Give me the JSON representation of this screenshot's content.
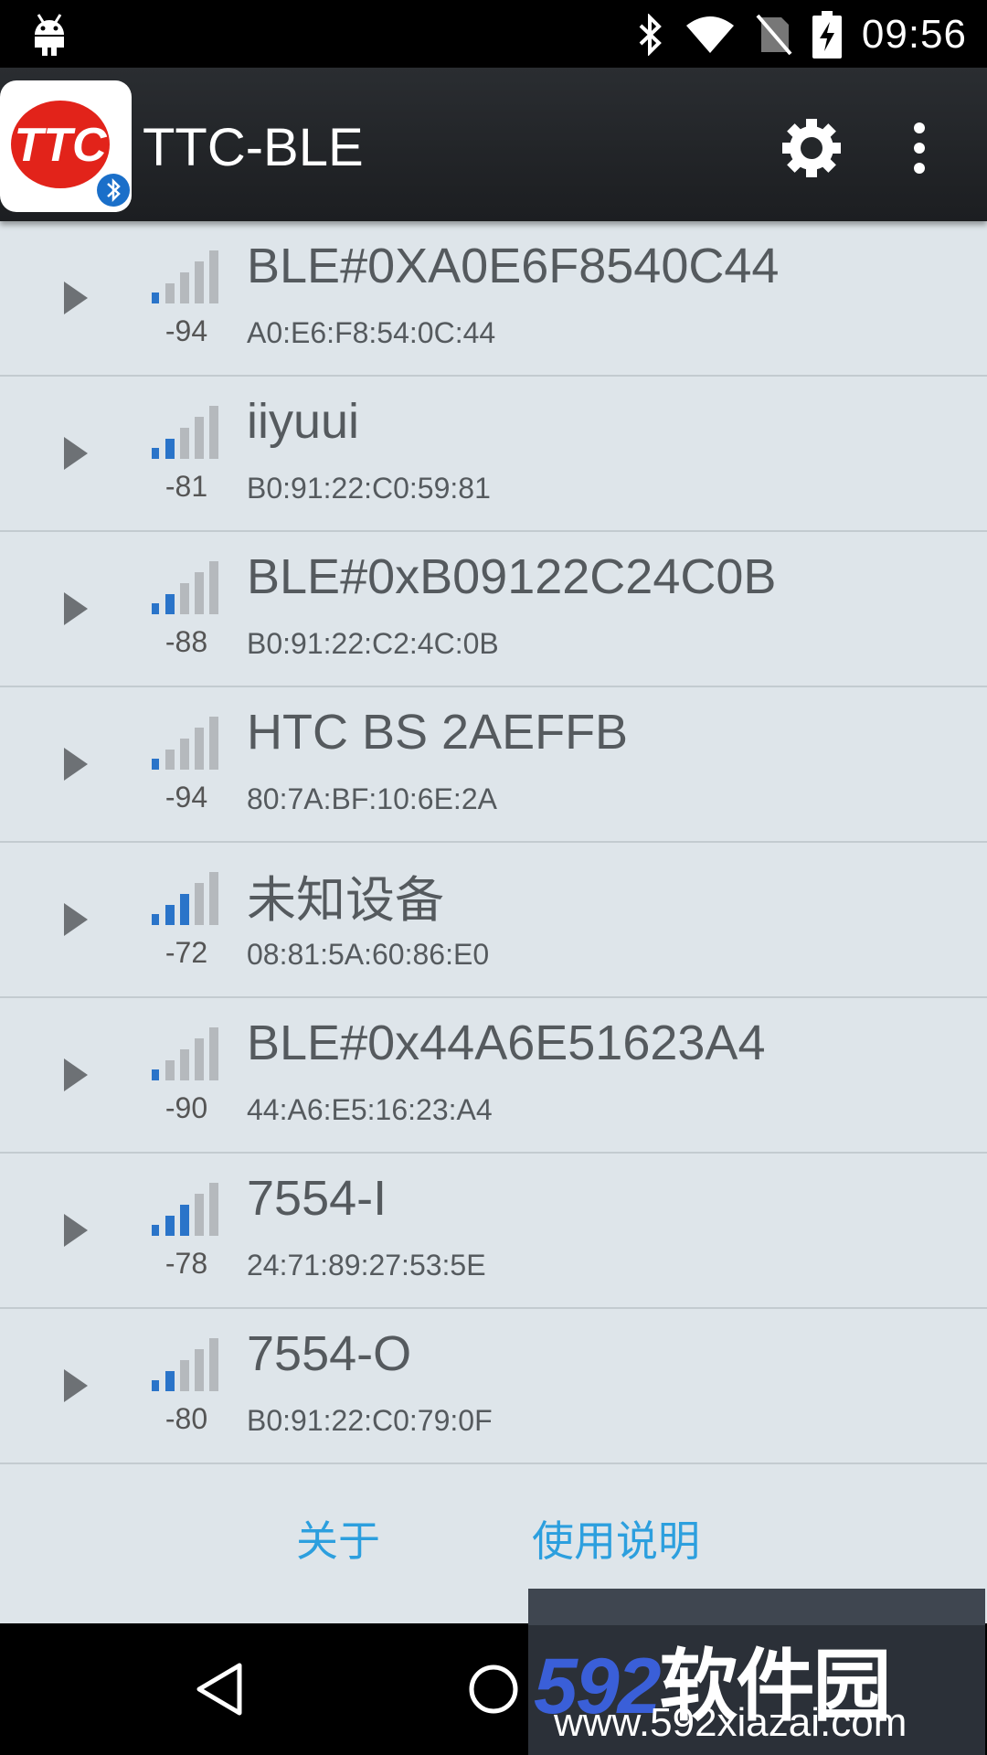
{
  "status_bar": {
    "time": "09:56",
    "icons": [
      "android-icon",
      "bluetooth-icon",
      "wifi-icon",
      "no-sim-icon",
      "battery-charging-icon"
    ]
  },
  "app": {
    "title": "TTC-BLE",
    "logo_text": "TTC",
    "actions": [
      "settings-icon",
      "overflow-menu-icon"
    ]
  },
  "devices": [
    {
      "name": "BLE#0XA0E6F8540C44",
      "mac": "A0:E6:F8:54:0C:44",
      "rssi": "-94",
      "bars": 1
    },
    {
      "name": "iiyuui",
      "mac": "B0:91:22:C0:59:81",
      "rssi": "-81",
      "bars": 2
    },
    {
      "name": "BLE#0xB09122C24C0B",
      "mac": "B0:91:22:C2:4C:0B",
      "rssi": "-88",
      "bars": 2
    },
    {
      "name": "HTC BS 2AEFFB",
      "mac": "80:7A:BF:10:6E:2A",
      "rssi": "-94",
      "bars": 1
    },
    {
      "name": "未知设备",
      "mac": "08:81:5A:60:86:E0",
      "rssi": "-72",
      "bars": 3
    },
    {
      "name": "BLE#0x44A6E51623A4",
      "mac": "44:A6:E5:16:23:A4",
      "rssi": "-90",
      "bars": 1
    },
    {
      "name": "7554-I",
      "mac": "24:71:89:27:53:5E",
      "rssi": "-78",
      "bars": 3
    },
    {
      "name": "7554-O",
      "mac": "B0:91:22:C0:79:0F",
      "rssi": "-80",
      "bars": 2
    }
  ],
  "footer": {
    "about_label": "关于",
    "guide_label": "使用说明"
  },
  "watermark": {
    "logo_num": "592",
    "logo_cn": "软件园",
    "url": "www.592xiazai.com"
  },
  "colors": {
    "accent": "#2c9fde",
    "signal_active": "#2a74c9",
    "signal_inactive": "#b5b9bd",
    "list_bg": "#dee5ea"
  }
}
